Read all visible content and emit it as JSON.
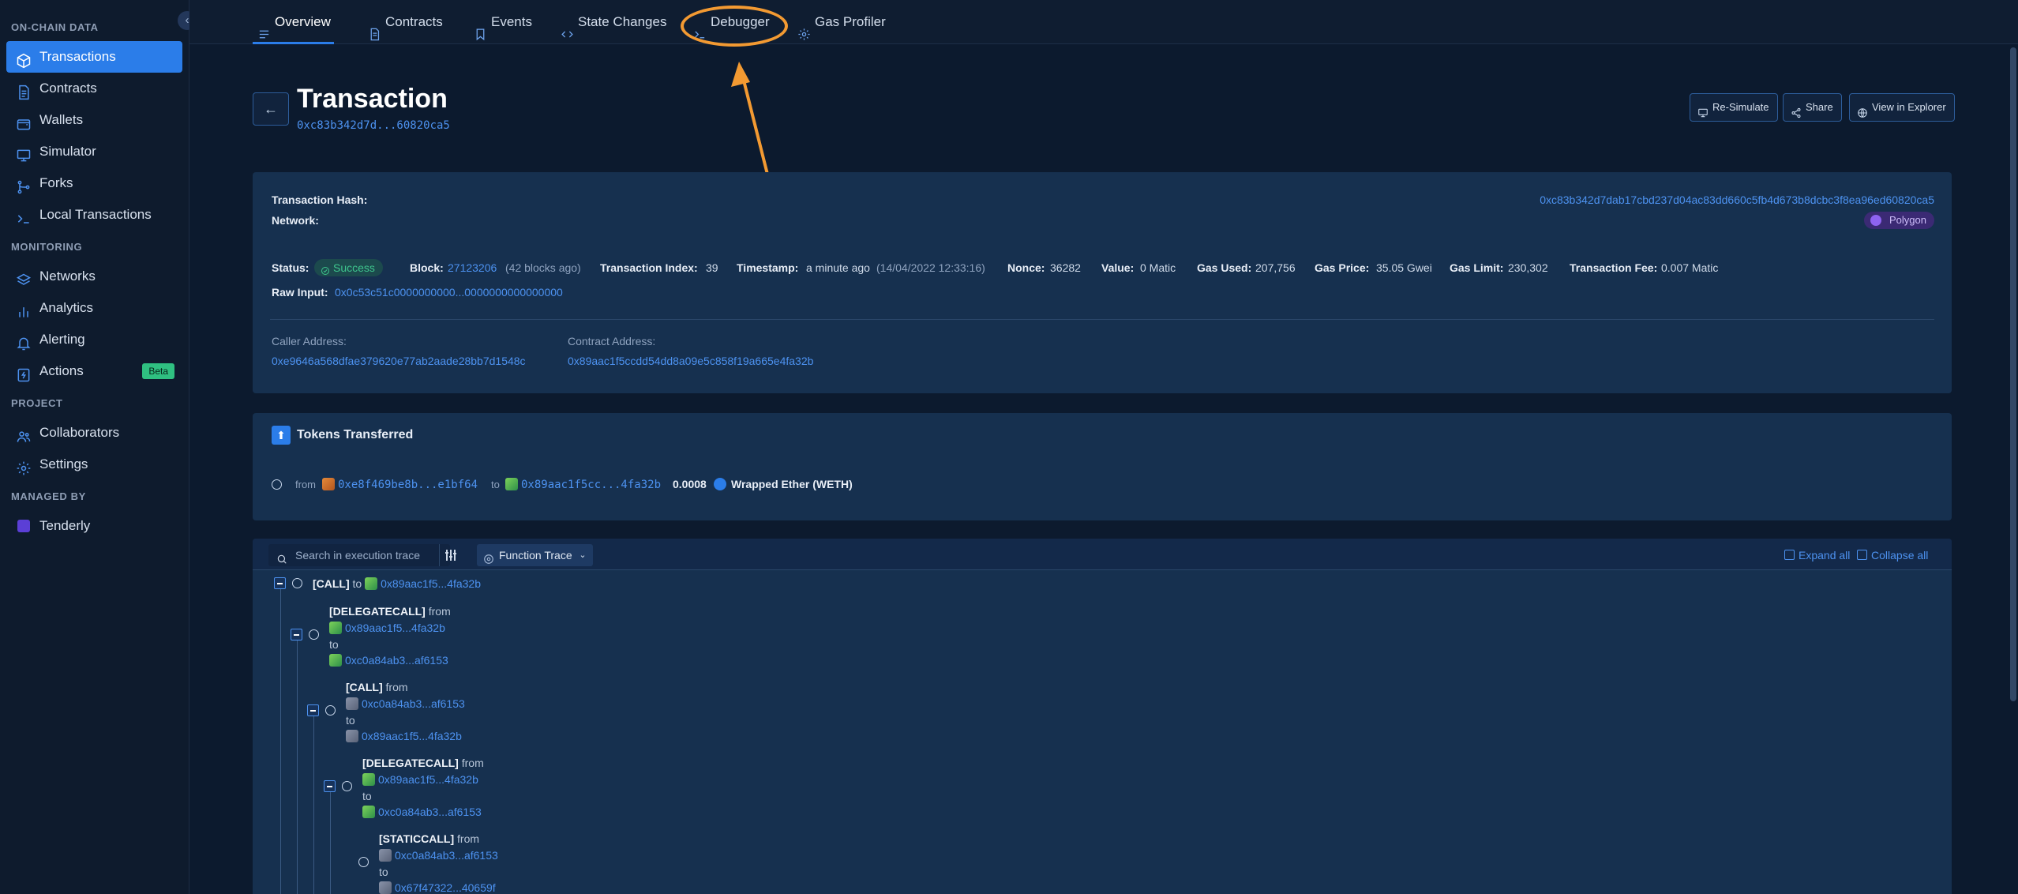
{
  "sidebar": {
    "sections": [
      {
        "title": "ON-CHAIN DATA",
        "items": [
          {
            "label": "Transactions",
            "icon": "cube-icon",
            "active": true
          },
          {
            "label": "Contracts",
            "icon": "document-icon"
          },
          {
            "label": "Wallets",
            "icon": "wallet-icon"
          },
          {
            "label": "Simulator",
            "icon": "monitor-icon"
          },
          {
            "label": "Forks",
            "icon": "fork-icon"
          },
          {
            "label": "Local Transactions",
            "icon": "terminal-icon"
          }
        ]
      },
      {
        "title": "MONITORING",
        "items": [
          {
            "label": "Networks",
            "icon": "layers-icon"
          },
          {
            "label": "Analytics",
            "icon": "bar-chart-icon"
          },
          {
            "label": "Alerting",
            "icon": "bell-icon"
          },
          {
            "label": "Actions",
            "icon": "bolt-icon",
            "badge": "Beta"
          }
        ]
      },
      {
        "title": "PROJECT",
        "items": [
          {
            "label": "Collaborators",
            "icon": "users-icon"
          },
          {
            "label": "Settings",
            "icon": "gear-icon"
          }
        ]
      },
      {
        "title": "MANAGED BY",
        "items": [
          {
            "label": "Tenderly",
            "icon": "tenderly-logo-icon"
          }
        ]
      }
    ]
  },
  "tabs": [
    {
      "label": "Overview",
      "active": true
    },
    {
      "label": "Contracts"
    },
    {
      "label": "Events"
    },
    {
      "label": "State Changes"
    },
    {
      "label": "Debugger"
    },
    {
      "label": "Gas Profiler"
    }
  ],
  "header": {
    "title": "Transaction",
    "hash_short": "0xc83b342d7d...60820ca5",
    "buttons": {
      "resimulate": "Re-Simulate",
      "share": "Share",
      "explorer": "View in Explorer"
    }
  },
  "details": {
    "tx_hash_label": "Transaction Hash:",
    "tx_hash": "0xc83b342d7dab17cbd237d04ac83dd660c5fb4d673b8dcbc3f8ea96ed60820ca5",
    "network_label": "Network:",
    "network": "Polygon",
    "status_label": "Status:",
    "status": "Success",
    "block_label": "Block:",
    "block": "27123206",
    "block_ago": "(42 blocks ago)",
    "tx_index_label": "Transaction Index:",
    "tx_index": "39",
    "timestamp_label": "Timestamp:",
    "timestamp": "a minute ago",
    "timestamp_full": "(14/04/2022 12:33:16)",
    "nonce_label": "Nonce:",
    "nonce": "36282",
    "value_label": "Value:",
    "value": "0 Matic",
    "gas_used_label": "Gas Used:",
    "gas_used": "207,756",
    "gas_price_label": "Gas Price:",
    "gas_price": "35.05 Gwei",
    "gas_limit_label": "Gas Limit:",
    "gas_limit": "230,302",
    "tx_fee_label": "Transaction Fee:",
    "tx_fee": "0.007 Matic",
    "raw_input_label": "Raw Input:",
    "raw_input": "0x0c53c51c0000000000...0000000000000000",
    "caller_label": "Caller Address:",
    "caller": "0xe9646a568dfae379620e77ab2aade28bb7d1548c",
    "contract_label": "Contract Address:",
    "contract": "0x89aac1f5ccdd54dd8a09e5c858f19a665e4fa32b"
  },
  "tokens": {
    "title": "Tokens Transferred",
    "from_word": "from",
    "from": "0xe8f469be8b...e1bf64",
    "to_word": "to",
    "to": "0x89aac1f5cc...4fa32b",
    "amount": "0.0008",
    "token": "Wrapped Ether (WETH)"
  },
  "trace": {
    "search_placeholder": "Search in execution trace",
    "mode": "Function Trace",
    "expand_all": "Expand all",
    "collapse_all": "Collapse all",
    "from_word": "from",
    "to_word": "to",
    "nodes": [
      {
        "type": "[CALL]",
        "to": "0x89aac1f5...4fa32b"
      },
      {
        "type": "[DELEGATECALL]",
        "from": "0x89aac1f5...4fa32b",
        "to": "0xc0a84ab3...af6153"
      },
      {
        "type": "[CALL]",
        "from": "0xc0a84ab3...af6153",
        "to": "0x89aac1f5...4fa32b"
      },
      {
        "type": "[DELEGATECALL]",
        "from": "0x89aac1f5...4fa32b",
        "to": "0xc0a84ab3...af6153"
      },
      {
        "type": "[STATICCALL]",
        "from": "0xc0a84ab3...af6153",
        "to": "0x67f47322...40659f"
      }
    ]
  },
  "annotation": {
    "color": "#f39a32"
  },
  "colors": {
    "accent": "#2b7de9",
    "success": "#3ec58d",
    "background": "#0c1a2e"
  }
}
